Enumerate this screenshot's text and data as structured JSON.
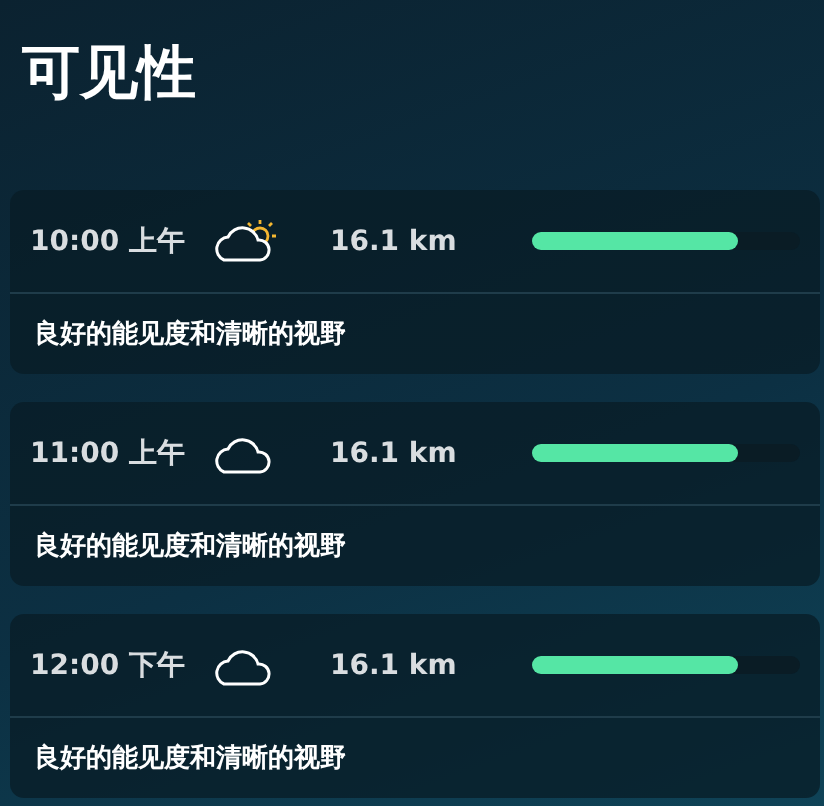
{
  "title": "可见性",
  "hours": [
    {
      "time": "10:00 上午",
      "icon": {
        "kind": "partly-sunny"
      },
      "distance": "16.1 km",
      "level": 0.77,
      "description": "良好的能见度和清晰的视野"
    },
    {
      "time": "11:00 上午",
      "icon": {
        "kind": "cloud"
      },
      "distance": "16.1 km",
      "level": 0.77,
      "description": "良好的能见度和清晰的视野"
    },
    {
      "time": "12:00 下午",
      "icon": {
        "kind": "cloud"
      },
      "distance": "16.1 km",
      "level": 0.77,
      "description": "良好的能见度和清晰的视野"
    }
  ]
}
